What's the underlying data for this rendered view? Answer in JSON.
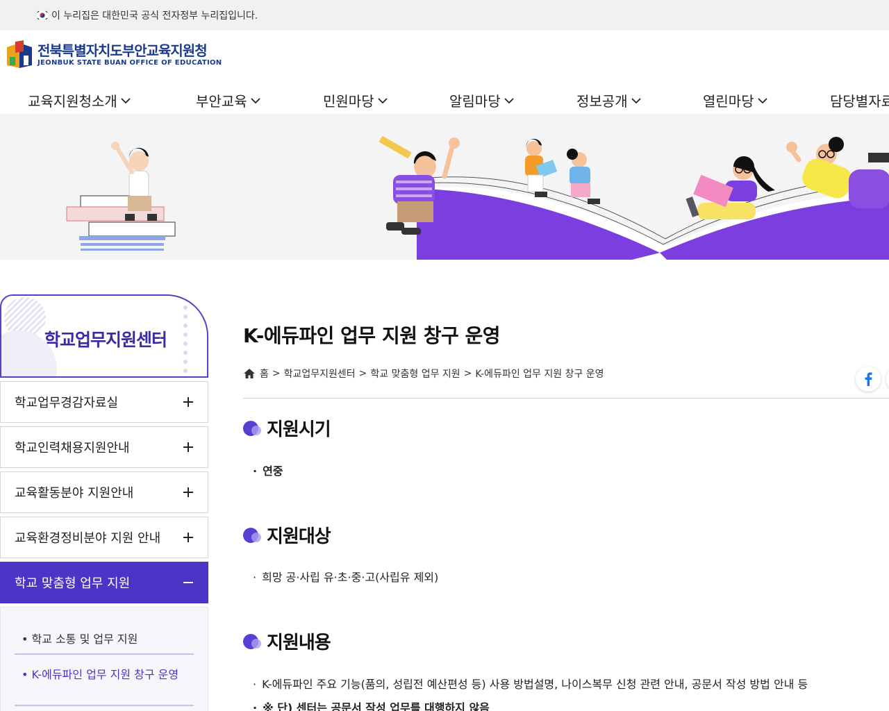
{
  "gov_banner": {
    "text": "이 누리집은 대한민국 공식 전자정부 누리집입니다."
  },
  "logo": {
    "kor": "전북특별자치도부안교육지원청",
    "eng": "JEONBUK STATE BUAN OFFICE OF EDUCATION"
  },
  "gnb": {
    "items": [
      {
        "label": "교육지원청소개"
      },
      {
        "label": "부안교육"
      },
      {
        "label": "민원마당"
      },
      {
        "label": "알림마당"
      },
      {
        "label": "정보공개"
      },
      {
        "label": "열린마당"
      },
      {
        "label": "담당별자료"
      }
    ]
  },
  "lnb": {
    "title": "학교업무지원센터",
    "items": [
      {
        "label": "학교업무경감자료실"
      },
      {
        "label": "학교인력채용지원안내"
      },
      {
        "label": "교육활동분야 지원안내"
      },
      {
        "label": "교육환경정비분야 지원 안내"
      },
      {
        "label": "학교 맞춤형 업무 지원"
      }
    ],
    "sub_items": [
      {
        "label": "학교 소통 및 업무 지원"
      },
      {
        "label": "K-에듀파인 업무 지원 창구 운영"
      }
    ]
  },
  "content": {
    "title": "K-에듀파인 업무 지원 창구 운영",
    "breadcrumb": [
      "홈",
      "학교업무지원센터",
      "학교 맞춤형 업무 지원",
      "K-에듀파인 업무 지원 창구 운영"
    ],
    "sections": [
      {
        "title": "지원시기",
        "items": [
          "연중"
        ]
      },
      {
        "title": "지원대상",
        "items": [
          "희망 공·사립 유·초·중·고(사립유 제외)"
        ]
      },
      {
        "title": "지원내용",
        "items": [
          "K-에듀파인 주요 기능(품의, 성립전 예산편성 등) 사용 방법설명, 나이스복무 신청 관련 안내, 공문서 작성 방법 안내 등",
          "※ 단) 센터는 공문서 작성 업무를 대행하지 않음"
        ]
      }
    ]
  },
  "colors": {
    "brand": "#4b34c6",
    "logo": "#1b3a8a",
    "facebook": "#1877f2"
  }
}
